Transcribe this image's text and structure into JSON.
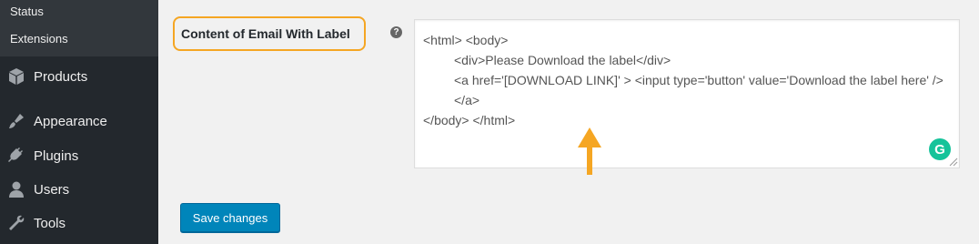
{
  "sidebar": {
    "subitems": [
      {
        "label": "Status"
      },
      {
        "label": "Extensions"
      }
    ],
    "items": [
      {
        "label": "Products",
        "icon": "products-icon"
      },
      {
        "label": "Appearance",
        "icon": "appearance-icon"
      },
      {
        "label": "Plugins",
        "icon": "plugins-icon"
      },
      {
        "label": "Users",
        "icon": "users-icon"
      },
      {
        "label": "Tools",
        "icon": "tools-icon"
      }
    ]
  },
  "field": {
    "label": "Content of Email With Label",
    "help_glyph": "?",
    "textarea_lines": [
      "<html> <body>",
      "<div>Please Download the label</div>",
      "<a href='[DOWNLOAD LINK]' > <input type='button' value='Download the label here' /> </a>",
      "</body> </html>"
    ],
    "grammarly_glyph": "G"
  },
  "save_button": {
    "label": "Save changes"
  },
  "colors": {
    "sidebar_bg": "#23282d",
    "highlight_orange": "#f5a623",
    "button_blue": "#0085ba",
    "grammarly_green": "#15c39a"
  }
}
